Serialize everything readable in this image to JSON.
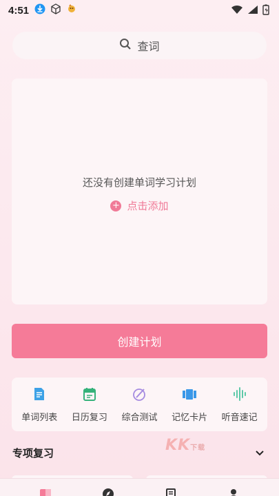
{
  "status_bar": {
    "time": "4:51"
  },
  "search": {
    "label": "查词"
  },
  "empty_state": {
    "message": "还没有创建单词学习计划",
    "add_label": "点击添加"
  },
  "create_button": {
    "label": "创建计划"
  },
  "tools": [
    {
      "label": "单词列表",
      "icon": "word-list-icon",
      "color": "#3da1e6"
    },
    {
      "label": "日历复习",
      "icon": "calendar-icon",
      "color": "#35b27a"
    },
    {
      "label": "综合测试",
      "icon": "test-icon",
      "color": "#a58be0"
    },
    {
      "label": "记忆卡片",
      "icon": "flashcard-icon",
      "color": "#3a98e8"
    },
    {
      "label": "听音速记",
      "icon": "audio-icon",
      "color": "#5dc9a8"
    }
  ],
  "section": {
    "title": "专项复习"
  },
  "watermark": {
    "text": "KK",
    "sub": "下载"
  },
  "colors": {
    "accent": "#f57b98",
    "background": "#fdeef2"
  }
}
